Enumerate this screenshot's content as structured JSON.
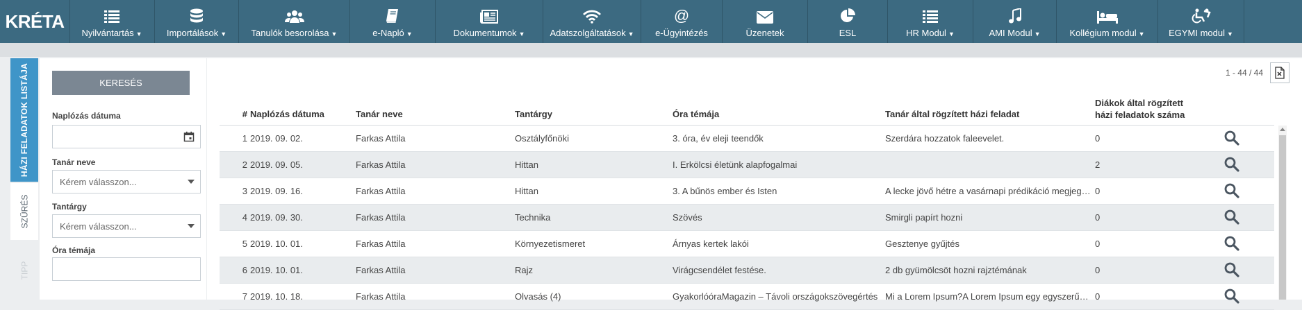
{
  "app": {
    "logo": "KRÉTA"
  },
  "nav": [
    {
      "label": "Nyilvántartás",
      "icon": "list-icon",
      "dropdown": true
    },
    {
      "label": "Importálások",
      "icon": "database-icon",
      "dropdown": true
    },
    {
      "label": "Tanulók besorolása",
      "icon": "users-icon",
      "dropdown": true
    },
    {
      "label": "e-Napló",
      "icon": "book-icon",
      "dropdown": true
    },
    {
      "label": "Dokumentumok",
      "icon": "newspaper-icon",
      "dropdown": true
    },
    {
      "label": "Adatszolgáltatások",
      "icon": "wifi-icon",
      "dropdown": true
    },
    {
      "label": "e-Ügyintézés",
      "icon": "at-icon",
      "dropdown": false
    },
    {
      "label": "Üzenetek",
      "icon": "envelope-icon",
      "dropdown": false
    },
    {
      "label": "ESL",
      "icon": "pie-chart-icon",
      "dropdown": false
    },
    {
      "label": "HR Modul",
      "icon": "list-icon",
      "dropdown": true
    },
    {
      "label": "AMI Modul",
      "icon": "music-icon",
      "dropdown": true
    },
    {
      "label": "Kollégium modul",
      "icon": "bed-icon",
      "dropdown": true
    },
    {
      "label": "EGYMI modul",
      "icon": "wheelchair-icon",
      "dropdown": true
    }
  ],
  "side_tabs": {
    "active": "HÁZI FELADATOK LISTÁJA",
    "second": "SZŰRÉS",
    "third": "TIPP"
  },
  "filter": {
    "search_button": "KERESÉS",
    "date_label": "Naplózás dátuma",
    "date_value": "",
    "teacher_label": "Tanár neve",
    "teacher_placeholder": "Kérem válasszon...",
    "subject_label": "Tantárgy",
    "subject_placeholder": "Kérem válasszon...",
    "topic_label": "Óra témája",
    "topic_value": ""
  },
  "grid": {
    "pager": "1 - 44 / 44",
    "headers": {
      "num": "#",
      "date": "Naplózás dátuma",
      "teacher": "Tanár neve",
      "subject": "Tantárgy",
      "topic": "Óra témája",
      "hw": "Tanár által rögzített házi feladat",
      "count_line1": "Diákok által rögzített",
      "count_line2": "házi feladatok száma"
    },
    "rows": [
      {
        "num": "1",
        "date": "2019. 09. 02.",
        "teacher": "Farkas Attila",
        "subject": "Osztályfőnöki",
        "topic": "3. óra, év eleji teendők",
        "hw": "Szerdára hozzatok faleevelet.",
        "count": "0"
      },
      {
        "num": "2",
        "date": "2019. 09. 05.",
        "teacher": "Farkas Attila",
        "subject": "Hittan",
        "topic": "I.   Erkölcsi életünk alapfogalmai",
        "hw": "",
        "count": "2"
      },
      {
        "num": "3",
        "date": "2019. 09. 16.",
        "teacher": "Farkas Attila",
        "subject": "Hittan",
        "topic": "3.  A bűnös ember és Isten",
        "hw": "A lecke jövő hétre a vasárnapi prédikáció megjegyzése",
        "count": "0"
      },
      {
        "num": "4",
        "date": "2019. 09. 30.",
        "teacher": "Farkas Attila",
        "subject": "Technika",
        "topic": "Szövés",
        "hw": "Smirgli papírt hozni",
        "count": "0"
      },
      {
        "num": "5",
        "date": "2019. 10. 01.",
        "teacher": "Farkas Attila",
        "subject": "Környezetismeret",
        "topic": "Árnyas kertek lakói",
        "hw": "Gesztenye gyűjtés",
        "count": "0"
      },
      {
        "num": "6",
        "date": "2019. 10. 01.",
        "teacher": "Farkas Attila",
        "subject": "Rajz",
        "topic": "Virágcsendélet festése.",
        "hw": "2 db gyümölcsöt hozni rajztémának",
        "count": "0"
      },
      {
        "num": "7",
        "date": "2019. 10. 18.",
        "teacher": "Farkas Attila",
        "subject": "Olvasás (4)",
        "topic": "GyakorlóóraMagazin – Távoli országokszövegértés",
        "hw": "Mi a Lorem Ipsum?A Lorem Ipsum egy egyszerű szövegrészlet",
        "count": "0"
      }
    ]
  },
  "colors": {
    "nav_bg": "#3c6a81",
    "active_tab": "#3f95c8",
    "search_btn": "#7b8793"
  }
}
